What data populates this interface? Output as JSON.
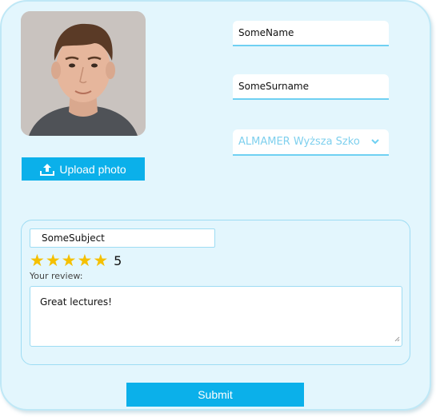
{
  "profile": {
    "upload_label": "Upload photo",
    "name_value": "SomeName",
    "surname_value": "SomeSurname",
    "university_selected": "ALMAMER Wyższa Szko"
  },
  "review": {
    "subject_value": "SomeSubject",
    "rating": 5,
    "rating_max": 5,
    "rating_label": "5",
    "review_label": "Your review:",
    "review_text": "Great lectures!"
  },
  "actions": {
    "submit_label": "Submit"
  },
  "colors": {
    "accent": "#0bb0ea",
    "card_bg": "#e3f6fd",
    "border": "#9edcf3",
    "star": "#f5c000"
  },
  "icons": {
    "upload": "upload-icon",
    "dropdown": "chevron-down-icon",
    "star": "star-icon"
  }
}
